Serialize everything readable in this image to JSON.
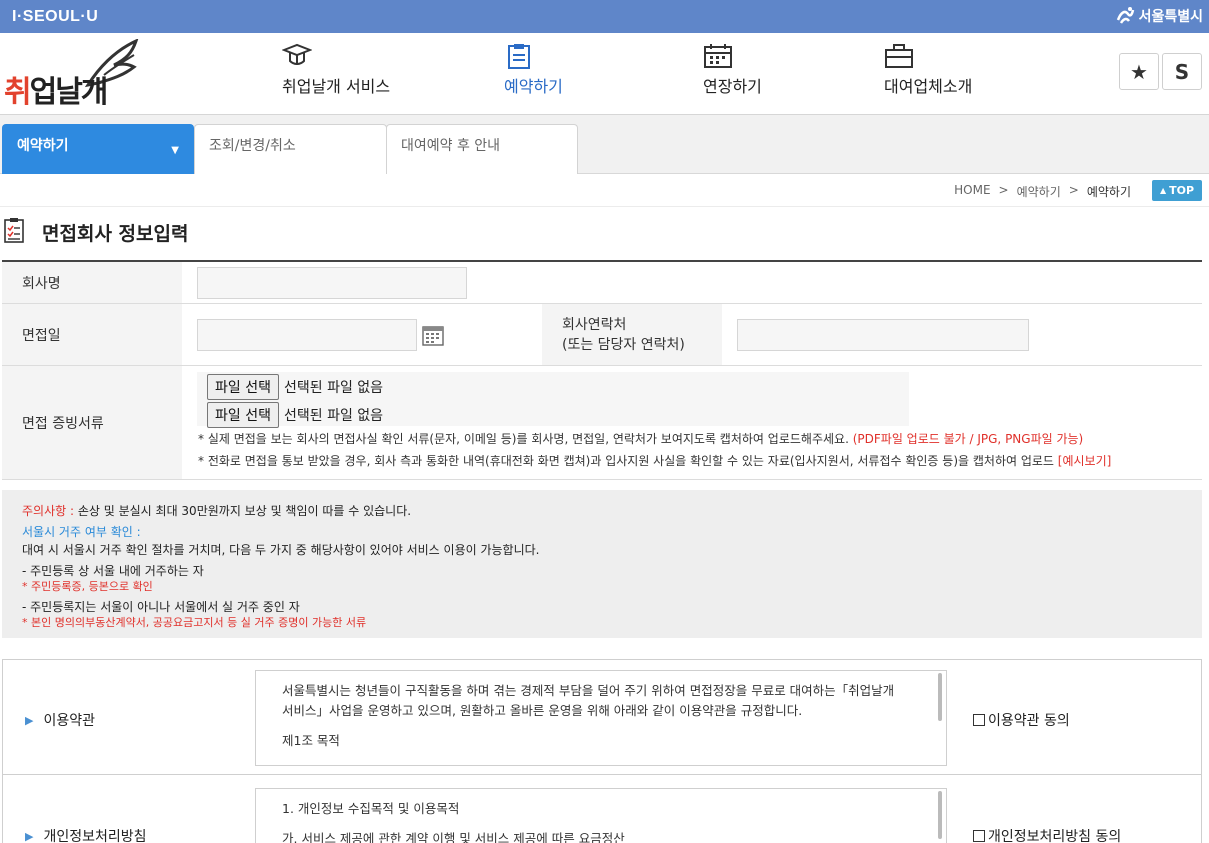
{
  "topbar": {
    "brand": "I·SEOUL·U",
    "city": "서울특별시"
  },
  "header": {
    "logo_text_a": "취",
    "logo_text_b": "업날개",
    "nav": [
      {
        "label": "취업날개 서비스",
        "icon": "graduation-cap-icon"
      },
      {
        "label": "예약하기",
        "icon": "clipboard-icon"
      },
      {
        "label": "연장하기",
        "icon": "calendar-icon"
      },
      {
        "label": "대여업체소개",
        "icon": "briefcase-icon"
      }
    ],
    "star_label": "★",
    "s_label": "S"
  },
  "tabs": [
    {
      "label": "예약하기",
      "caret": "▼"
    },
    {
      "label": "조회/변경/취소"
    },
    {
      "label": "대여예약 후 안내"
    }
  ],
  "breadcrumb": {
    "home": "HOME",
    "sep": ">",
    "mid": "예약하기",
    "current": "예약하기"
  },
  "top_button": {
    "label": "TOP",
    "arrow": "▲"
  },
  "section": {
    "title": "면접회사 정보입력"
  },
  "form": {
    "company_label": "회사명",
    "company_value": "",
    "date_label": "면접일",
    "date_value": "",
    "contact_label_1": "회사연락처",
    "contact_label_2": "(또는 담당자 연락처)",
    "contact_value": "",
    "proof_label": "면접 증빙서류",
    "file_button": "파일 선택",
    "file_status": "선택된 파일 없음",
    "note1_text": "* 실제 면접을 보는 회사의 면접사실 확인 서류(문자, 이메일 등)를 회사명, 면접일, 연락처가 보여지도록 캡처하여 업로드해주세요.",
    "note1_red": "(PDF파일 업로드 불가 / JPG, PNG파일 가능)",
    "note2_text": "* 전화로 면접을 통보 받았을 경우, 회사 측과 통화한 내역(휴대전화 화면 캡쳐)과 입사지원 사실을 확인할 수 있는 자료(입사지원서, 서류접수 확인증 등)을 캡처하여 업로드",
    "note2_red": "[예시보기]"
  },
  "notice": {
    "caution_label": "주의사항 :",
    "caution_text": " 손상 및 분실시 최대 30만원까지 보상 및 책임이 따를 수 있습니다.",
    "residence_title": "서울시 거주 여부 확인 :",
    "residence_text": "대여 시 서울시 거주 확인 절차를 거치며, 다음 두 가지 중 해당사항이 있어야 서비스 이용이 가능합니다.",
    "item1": "- 주민등록 상 서울 내에 거주하는 자",
    "item1_note": "* 주민등록증, 등본으로 확인",
    "item2": "- 주민등록지는 서울이 아니나 서울에서 실 거주 중인 자",
    "item2_note": "* 본인 명의의부동산계약서, 공공요금고지서 등 실 거주 증명이 가능한 서류"
  },
  "agreements": [
    {
      "label": "이용약관",
      "text1": "서울특별시는 청년들이 구직활동을 하며 겪는 경제적 부담을 덜어 주기 위하여 면접정장을 무료로 대여하는「취업날개",
      "text2": "서비스」사업을 운영하고 있으며, 원활하고 올바른 운영을 위해 아래와 같이 이용약관을 규정합니다.",
      "text3": "제1조 목적",
      "check_label": "이용약관 동의"
    },
    {
      "label": "개인정보처리방침",
      "text1": "1. 개인정보 수집목적 및 이용목적",
      "text2": "가. 서비스 제공에 관한 계약 이행 및 서비스 제공에 따른 요금정산",
      "check_label": "개인정보처리방침 동의"
    }
  ]
}
